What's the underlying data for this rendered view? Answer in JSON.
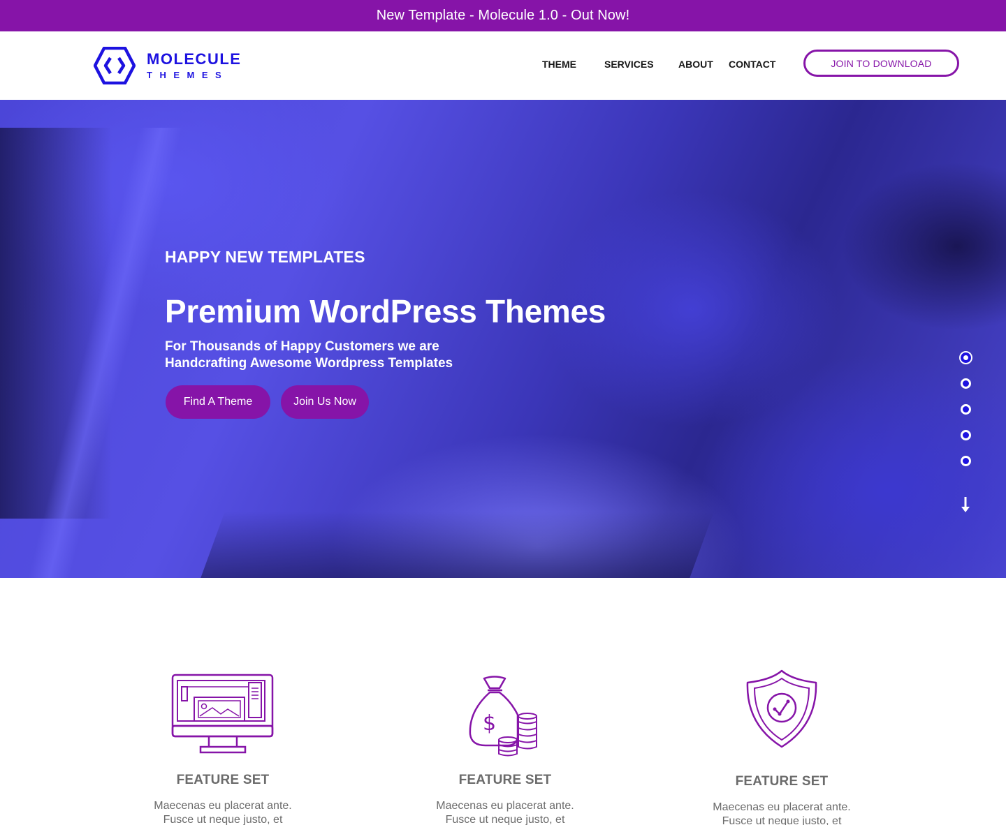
{
  "announcement": {
    "text": "New Template - Molecule 1.0 - Out Now!"
  },
  "brand": {
    "name_line1": "MOLECULE",
    "name_line2": "THEMES",
    "color": "#1d12e0"
  },
  "nav": {
    "items": [
      {
        "label": "THEME"
      },
      {
        "label": "SERVICES"
      },
      {
        "label": "ABOUT"
      },
      {
        "label": "CONTACT"
      }
    ],
    "cta_label": "JOIN TO DOWNLOAD"
  },
  "hero": {
    "kicker": "HAPPY NEW TEMPLATES",
    "title": "Premium WordPress Themes",
    "subtitle_line1": "For Thousands of Happy Customers we are",
    "subtitle_line2": "Handcrafting Awesome Wordpress Templates",
    "primary_button": "Find A Theme",
    "secondary_button": "Join Us Now",
    "slides_count": 5,
    "active_slide": 1,
    "scroll_icon": "arrow-down-icon"
  },
  "features": [
    {
      "icon": "monitor-design-icon",
      "title": "FEATURE SET",
      "text_line1": "Maecenas eu placerat ante.",
      "text_line2": "Fusce ut neque justo, et"
    },
    {
      "icon": "money-bag-coins-icon",
      "title": "FEATURE SET",
      "text_line1": "Maecenas eu placerat ante.",
      "text_line2": "Fusce ut neque justo, et"
    },
    {
      "icon": "shield-check-icon",
      "title": "FEATURE SET",
      "text_line1": "Maecenas eu placerat ante.",
      "text_line2": "Fusce ut neque justo, et"
    }
  ],
  "colors": {
    "accent_purple": "#8614a8",
    "brand_blue": "#1d12e0",
    "hero_tint": "#4b46d8",
    "feature_text": "#6b6b6b"
  }
}
